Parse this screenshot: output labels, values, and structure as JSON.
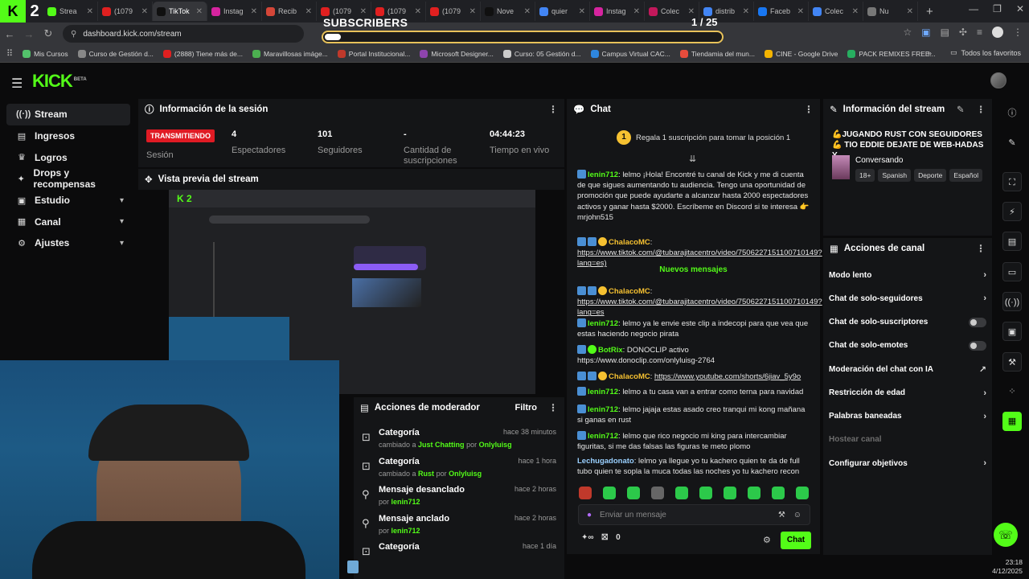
{
  "browser": {
    "tabs": [
      {
        "label": "Strea",
        "color": "#53fc18",
        "active": false
      },
      {
        "label": "(1079",
        "color": "#e02020",
        "active": false
      },
      {
        "label": "TikTok",
        "color": "#101010",
        "active": true
      },
      {
        "label": "Instag",
        "color": "#d6249f",
        "active": false
      },
      {
        "label": "Recib",
        "color": "#d44638",
        "active": false
      },
      {
        "label": "(1079",
        "color": "#e02020",
        "active": false
      },
      {
        "label": "(1079",
        "color": "#e02020",
        "active": false
      },
      {
        "label": "(1079",
        "color": "#e02020",
        "active": false
      },
      {
        "label": "Nove",
        "color": "#101010",
        "active": false
      },
      {
        "label": "quier",
        "color": "#4285f4",
        "active": false
      },
      {
        "label": "Instag",
        "color": "#d6249f",
        "active": false
      },
      {
        "label": "Colec",
        "color": "#c2185b",
        "active": false
      },
      {
        "label": "distrib",
        "color": "#4285f4",
        "active": false
      },
      {
        "label": "Faceb",
        "color": "#1877f2",
        "active": false
      },
      {
        "label": "Colec",
        "color": "#4285f4",
        "active": false
      },
      {
        "label": "Nu",
        "color": "#777777",
        "active": false
      }
    ],
    "url": "dashboard.kick.com/stream",
    "bookmarks": [
      {
        "label": "Mis Cursos",
        "color": "#53c26b"
      },
      {
        "label": "Curso de Gestión d...",
        "color": "#888888"
      },
      {
        "label": "(2888) Tiene más de...",
        "color": "#e02020"
      },
      {
        "label": "Maravillosas imáge...",
        "color": "#4caf50"
      },
      {
        "label": "Portal Institucional...",
        "color": "#c0392b"
      },
      {
        "label": "Microsoft Designer...",
        "color": "#8e44ad"
      },
      {
        "label": "Curso: 05 Gestión d...",
        "color": "#cccccc"
      },
      {
        "label": "Campus Virtual CAC...",
        "color": "#2e86de"
      },
      {
        "label": "Tiendamia del mun...",
        "color": "#e74c3c"
      },
      {
        "label": "CINE - Google Drive",
        "color": "#f4b400"
      },
      {
        "label": "PACK REMIXES FREE...",
        "color": "#27ae60"
      }
    ],
    "all_bookmarks": "Todos los favoritos"
  },
  "overlay": {
    "subs_label": "SUBSCRIBERS",
    "subs_count": "1 / 25",
    "subs_progress": 0.04
  },
  "kick": {
    "logo": "KICK",
    "logo_beta": "BETA"
  },
  "sidebar": {
    "items": [
      {
        "label": "Stream",
        "icon": "stream-icon",
        "glyph": "((·))"
      },
      {
        "label": "Ingresos",
        "icon": "wallet-icon",
        "glyph": "▤"
      },
      {
        "label": "Logros",
        "icon": "trophy-icon",
        "glyph": "♛"
      },
      {
        "label": "Drops y recompensas",
        "icon": "gift-icon",
        "glyph": "✦"
      },
      {
        "label": "Estudio",
        "icon": "studio-icon",
        "glyph": "▣"
      },
      {
        "label": "Canal",
        "icon": "channel-icon",
        "glyph": "▦"
      },
      {
        "label": "Ajustes",
        "icon": "gear-icon",
        "glyph": "⚙"
      }
    ]
  },
  "session": {
    "title": "Información de la sesión",
    "live_badge": "TRANSMITIENDO",
    "session_label": "Sesión",
    "stats": [
      {
        "value": "4",
        "label": "Espectadores"
      },
      {
        "value": "101",
        "label": "Seguidores"
      },
      {
        "value": "-",
        "label": "Cantidad de suscripciones"
      },
      {
        "value": "04:44:23",
        "label": "Tiempo en vivo"
      }
    ]
  },
  "preview": {
    "title": "Vista previa del stream"
  },
  "moderator": {
    "title": "Acciones de moderador",
    "filter": "Filtro",
    "items": [
      {
        "title": "Categoría",
        "sub": "cambiado a",
        "target": "Just Chatting",
        "by": "por",
        "user": "Onlyluisg",
        "time": "hace 38 minutos",
        "icon": "category-icon"
      },
      {
        "title": "Categoría",
        "sub": "cambiado a",
        "target": "Rust",
        "by": "por",
        "user": "Onlyluisg",
        "time": "hace 1 hora",
        "icon": "category-icon"
      },
      {
        "title": "Mensaje desanclado",
        "sub": "por",
        "target": "lenin712",
        "by": "",
        "user": "",
        "time": "hace 2 horas",
        "icon": "unpin-icon"
      },
      {
        "title": "Mensaje anclado",
        "sub": "por",
        "target": "lenin712",
        "by": "",
        "user": "",
        "time": "hace 2 horas",
        "icon": "pin-icon"
      },
      {
        "title": "Categoría",
        "sub": "",
        "target": "",
        "by": "",
        "user": "",
        "time": "hace 1 día",
        "icon": "category-icon"
      }
    ]
  },
  "chat": {
    "title": "Chat",
    "pinned_rank": "1",
    "pinned_text": "Regala 1 suscripción para tomar la posición 1",
    "new_messages": "Nuevos mensajes",
    "messages": [
      {
        "user": "lenin712",
        "color": "#53fc18",
        "text": "lelmo ¡Hola! Encontré tu canal de Kick y me di cuenta de que sigues aumentando tu audiencia. Tengo una oportunidad de promoción que puede ayudarte a alcanzar hasta 2000 espectadores activos y ganar hasta $2000. Escríbeme en Discord si te interesa 👉 mrjohn515",
        "link": false
      },
      {
        "user": "ChalacoMC",
        "color": "#f6c131",
        "text": "https://www.tiktok.com/@tubarajitacentro/video/7506227151100710149?lang=es)",
        "link": true
      },
      {
        "user": "ChalacoMC",
        "color": "#f6c131",
        "text": "https://www.tiktok.com/@tubarajitacentro/video/7506227151100710149?lang=es",
        "link": true
      },
      {
        "user": "lenin712",
        "color": "#53fc18",
        "text": "lelmo ya le envie este clip a indecopi para que vea que estas haciendo negocio pirata",
        "link": false
      },
      {
        "user": "BotRix",
        "color": "#53fc18",
        "text": "DONOCLIP activo https://www.donoclip.com/onlyluisg-2764",
        "link": false
      },
      {
        "user": "ChalacoMC",
        "color": "#f6c131",
        "text": "https://www.youtube.com/shorts/6jiav_5y9o",
        "link": true
      },
      {
        "user": "lenin712",
        "color": "#53fc18",
        "text": "lelmo a tu casa van a entrar como terna para navidad",
        "link": false
      },
      {
        "user": "lenin712",
        "color": "#53fc18",
        "text": "lelmo jajaja estas asado creo tranqui mi kong mañana si ganas en rust",
        "link": false
      },
      {
        "user": "lenin712",
        "color": "#53fc18",
        "text": "lelmo que rico negocio mi king para intercambiar figuritas, si me das falsas las figuras te meto plomo",
        "link": false
      },
      {
        "user": "Lechugadonato",
        "color": "#9ad0ff",
        "text": "lelmo ya llegue yo tu kachero quien te da de full tubo quien te sopla la muca todas las noches yo tu kachero recon",
        "link": false
      }
    ],
    "input_placeholder": "Enviar un mensaje",
    "points": "0",
    "send_label": "Chat"
  },
  "stream_info": {
    "title": "Información del stream",
    "stream_title": "💪JUGANDO RUST CON SEGUIDORES💪 TIO EDDIE DEJATE DE WEB-HADAS Y...",
    "category": "Conversando",
    "tags": [
      "18+",
      "Spanish",
      "Deporte",
      "Español"
    ]
  },
  "channel_actions": {
    "title": "Acciones de canal",
    "items": [
      {
        "label": "Modo lento",
        "control": "chevron"
      },
      {
        "label": "Chat de solo-seguidores",
        "control": "chevron"
      },
      {
        "label": "Chat de solo-suscriptores",
        "control": "toggle"
      },
      {
        "label": "Chat de solo-emotes",
        "control": "toggle"
      },
      {
        "label": "Moderación del chat con IA",
        "control": "external"
      },
      {
        "label": "Restricción de edad",
        "control": "chevron"
      },
      {
        "label": "Palabras baneadas",
        "control": "chevron"
      },
      {
        "label": "Hostear canal",
        "control": "none"
      },
      {
        "label": "Configurar objetivos",
        "control": "chevron"
      }
    ]
  },
  "taskbar": {
    "time": "23:18",
    "date": "4/12/2025"
  }
}
